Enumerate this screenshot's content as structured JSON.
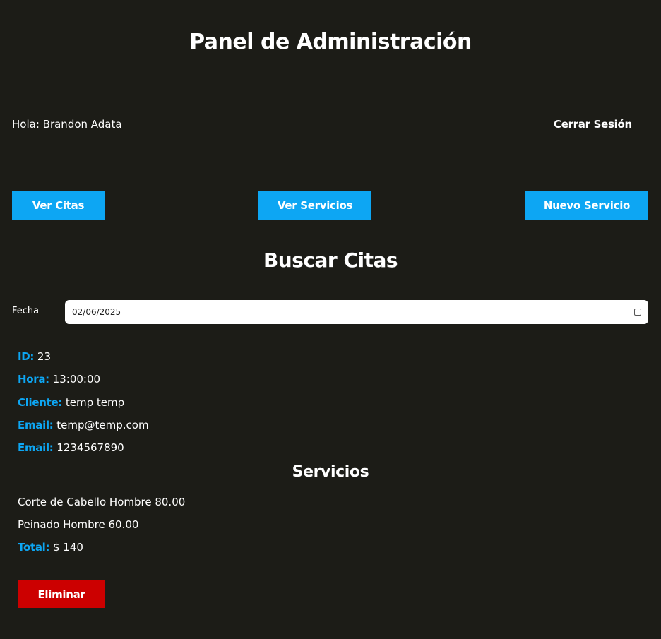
{
  "header": {
    "title": "Panel de Administración",
    "greeting_label": "Hola:",
    "user_name": "Brandon Adata",
    "logout_label": "Cerrar Sesión"
  },
  "nav": {
    "ver_citas": "Ver Citas",
    "ver_servicios": "Ver Servicios",
    "nuevo_servicio": "Nuevo Servicio"
  },
  "search": {
    "title": "Buscar Citas",
    "date_label": "Fecha",
    "date_value": "02/06/2025"
  },
  "appointment": {
    "id_label": "ID:",
    "id": "23",
    "hora_label": "Hora:",
    "hora": "13:00:00",
    "cliente_label": "Cliente:",
    "cliente": "temp temp",
    "email_label": "Email:",
    "email": "temp@temp.com",
    "telefono_label": "Email:",
    "telefono": "1234567890",
    "services_title": "Servicios",
    "services": [
      "Corte de Cabello Hombre 80.00",
      "Peinado Hombre 60.00"
    ],
    "total_label": "Total:",
    "total": "$ 140",
    "delete_label": "Eliminar"
  },
  "colors": {
    "background": "#1c1c17",
    "accent": "#0da6f3",
    "danger": "#cc0000"
  }
}
